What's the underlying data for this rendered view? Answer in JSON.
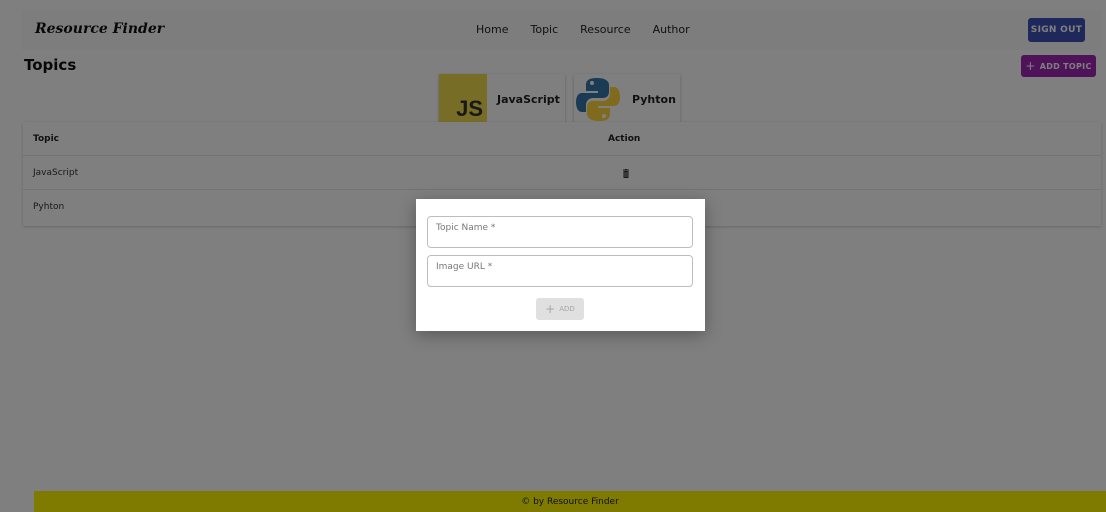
{
  "app": {
    "brand": "Resource Finder"
  },
  "nav": {
    "links": [
      "Home",
      "Topic",
      "Resource",
      "Author"
    ],
    "signout_label": "SIGN OUT"
  },
  "page": {
    "title": "Topics",
    "add_topic_label": "ADD TOPIC",
    "add_topic_icon": "plus-icon"
  },
  "cards": [
    {
      "label": "JavaScript",
      "logo_text": "JS",
      "icon": "javascript-logo"
    },
    {
      "label": "Pyhton",
      "icon": "python-logo"
    }
  ],
  "table": {
    "headers": {
      "topic": "Topic",
      "action": "Action"
    },
    "rows": [
      {
        "topic": "JavaScript",
        "action_icon": "trash-icon"
      },
      {
        "topic": "Pyhton",
        "action_icon": "trash-icon"
      }
    ]
  },
  "dialog": {
    "topic_name_label": "Topic Name *",
    "image_url_label": "Image URL *",
    "add_label": "ADD",
    "add_icon": "plus-icon"
  },
  "footer": {
    "text": "© by Resource Finder"
  },
  "colors": {
    "signout": "#3f51b5",
    "add_topic": "#9c27b0",
    "footer": "#fff500",
    "overlay": "rgba(0,0,0,0.5)"
  }
}
